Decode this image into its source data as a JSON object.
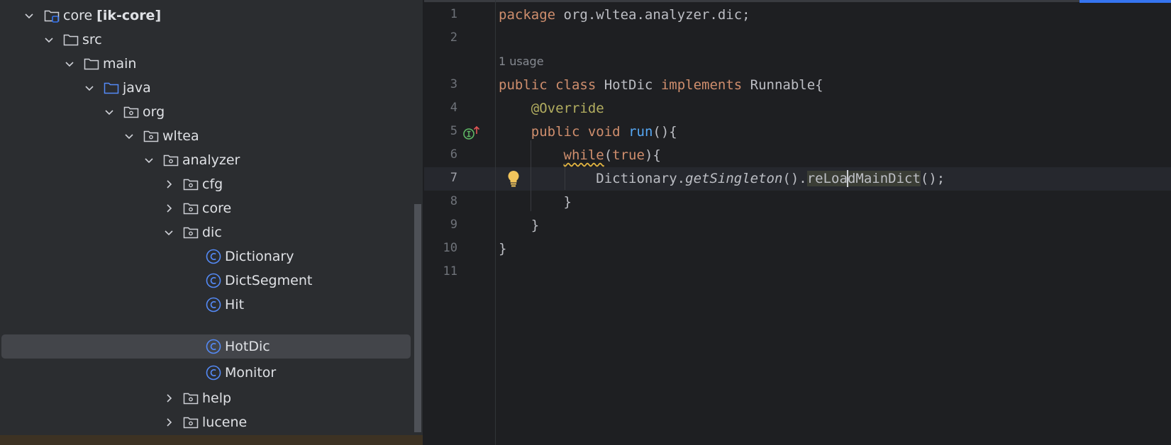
{
  "project_tree": {
    "items": [
      {
        "name": "core",
        "suffix": "[ik-core]"
      },
      {
        "name": "src"
      },
      {
        "name": "main"
      },
      {
        "name": "java"
      },
      {
        "name": "org"
      },
      {
        "name": "wltea"
      },
      {
        "name": "analyzer"
      },
      {
        "name": "cfg"
      },
      {
        "name": "core"
      },
      {
        "name": "dic"
      },
      {
        "name": "Dictionary"
      },
      {
        "name": "DictSegment"
      },
      {
        "name": "Hit"
      },
      {
        "name": "HotDic"
      },
      {
        "name": "Monitor"
      },
      {
        "name": "help"
      },
      {
        "name": "lucene"
      }
    ],
    "selected": "HotDic"
  },
  "editor": {
    "line_numbers": [
      "1",
      "2",
      "3",
      "4",
      "5",
      "6",
      "7",
      "8",
      "9",
      "10",
      "11"
    ],
    "current_line": "7",
    "usage_hint": "1 usage",
    "code": {
      "l1_kw": "package",
      "l1_rest": " org.wltea.analyzer.dic;",
      "l3_kw1": "public",
      "l3_kw2": "class",
      "l3_name": " HotDic ",
      "l3_kw3": "implements",
      "l3_rest": " Runnable{",
      "l4_ann": "@Override",
      "l5_kw1": "public",
      "l5_kw2": "void",
      "l5_fn": "run",
      "l5_rest": "(){",
      "l6_kw": "while",
      "l6_open": "(",
      "l6_kw2": "true",
      "l6_rest": "){",
      "l7_cls": "Dictionary.",
      "l7_method": "getSingleton",
      "l7_mid": "().",
      "l7_word_a": "reLoa",
      "l7_word_b": "dMainDict",
      "l7_rest": "();",
      "l8": "}",
      "l9": "}",
      "l10": "}"
    }
  },
  "colors": {
    "keyword": "#cf8e6d",
    "method": "#56a8f5",
    "annotation": "#b3ae60",
    "text": "#bcbec4",
    "accent": "#3574f0"
  },
  "icons": [
    "chevron-down-icon",
    "chevron-right-icon",
    "folder-icon",
    "module-folder-icon",
    "source-folder-icon",
    "package-icon",
    "class-icon",
    "implements-marker-icon",
    "lightbulb-icon"
  ]
}
